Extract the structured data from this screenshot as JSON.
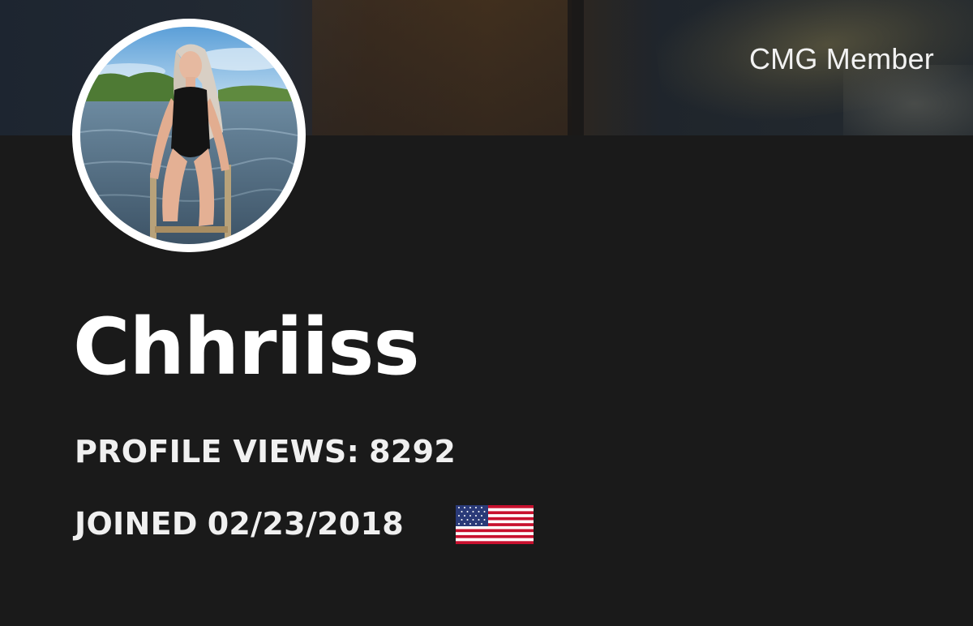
{
  "banner": {
    "member_label": "CMG Member"
  },
  "profile": {
    "username": "Chhriiss",
    "views_label": "PROFILE VIEWS:",
    "views_value": "8292",
    "joined_label": "JOINED",
    "joined_value": "02/23/2018",
    "country_flag_icon": "us-flag-icon"
  },
  "colors": {
    "background": "#1a1a1a",
    "text": "#ffffff",
    "avatar_border": "#ffffff"
  }
}
